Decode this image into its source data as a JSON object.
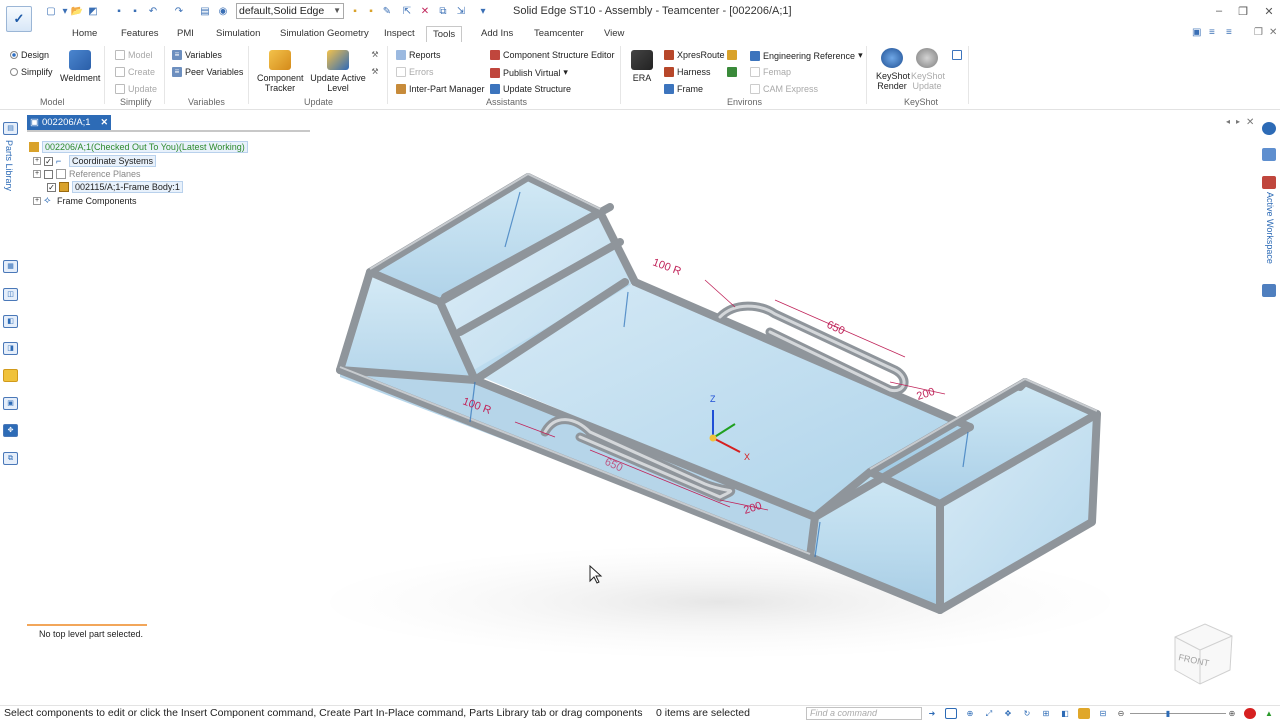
{
  "window": {
    "title": "Solid Edge ST10 - Assembly - Teamcenter - [002206/A;1]",
    "doc_combo_value": "default,Solid Edge"
  },
  "ribbon_tabs": [
    {
      "label": "Home"
    },
    {
      "label": "Features"
    },
    {
      "label": "PMI"
    },
    {
      "label": "Simulation"
    },
    {
      "label": "Simulation Geometry"
    },
    {
      "label": "Inspect"
    },
    {
      "label": "Tools"
    },
    {
      "label": "Add Ins"
    },
    {
      "label": "Teamcenter"
    },
    {
      "label": "View"
    }
  ],
  "active_tab": "Tools",
  "ribbon": {
    "model": {
      "design": "Design",
      "simplify": "Simplify",
      "weldment": "Weldment",
      "group": "Model"
    },
    "simplify": {
      "model": "Model",
      "create": "Create",
      "update": "Update",
      "group": "Simplify"
    },
    "variables": {
      "variables": "Variables",
      "peer_variables": "Peer Variables",
      "group": "Variables"
    },
    "update": {
      "component_tracker": "Component Tracker",
      "update_active_level": "Update Active Level",
      "group": "Update"
    },
    "assistants": {
      "reports": "Reports",
      "errors": "Errors",
      "inter_part_manager": "Inter-Part Manager",
      "component_structure_editor": "Component Structure Editor",
      "publish_virtual": "Publish Virtual",
      "update_structure": "Update Structure",
      "group": "Assistants"
    },
    "environs": {
      "era": "ERA",
      "xpresroute": "XpresRoute",
      "harness": "Harness",
      "frame": "Frame",
      "engineering_reference": "Engineering Reference",
      "femap": "Femap",
      "cam_express": "CAM Express",
      "group": "Environs"
    },
    "keyshot": {
      "render": "KeyShot Render",
      "update": "KeyShot Update",
      "group": "KeyShot"
    }
  },
  "document_tab": {
    "label": "002206/A;1"
  },
  "left_panel": {
    "parts_library": "Parts Library"
  },
  "tree": {
    "root": "002206/A;1(Checked Out To You)(Latest Working)",
    "items": [
      {
        "label": "Coordinate Systems",
        "checked": true
      },
      {
        "label": "Reference Planes",
        "checked": false
      },
      {
        "label": "002115/A;1-Frame Body:1",
        "checked": true
      },
      {
        "label": "Frame Components"
      }
    ]
  },
  "right_panel": {
    "active_workspace": "Active Workspace"
  },
  "model": {
    "dimensions": {
      "radius_top": "100 R",
      "length_top": "650",
      "offset_top": "200",
      "radius_bottom": "100 R",
      "length_bottom": "650",
      "offset_bottom": "200"
    },
    "axes": {
      "z": "Z",
      "x": "X"
    },
    "view_cube": "FRONT",
    "colors": {
      "frame": "#8f959b",
      "glass": "#b9dbef",
      "dimension": "#c0245a"
    }
  },
  "prompt": "No top level part selected.",
  "statusbar": {
    "message": "Select components to edit or click the Insert Component command, Create Part In-Place command, Parts Library tab or drag components",
    "items_selected": "0 items are selected",
    "find_command_placeholder": "Find a command"
  }
}
